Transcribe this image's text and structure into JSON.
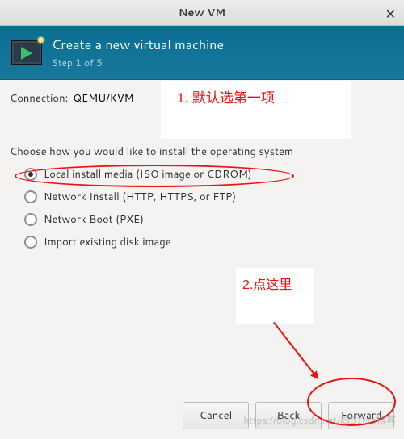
{
  "window": {
    "title": "New VM",
    "close_glyph": "✕"
  },
  "header": {
    "title": "Create a new virtual machine",
    "step": "Step 1 of 5"
  },
  "connection": {
    "label": "Connection:",
    "value": "QEMU/KVM"
  },
  "choose_label": "Choose how you would like to install the operating system",
  "options": [
    {
      "label": "Local install media (ISO image or CDROM)",
      "selected": true
    },
    {
      "label": "Network Install (HTTP, HTTPS, or FTP)",
      "selected": false
    },
    {
      "label": "Network Boot (PXE)",
      "selected": false
    },
    {
      "label": "Import existing disk image",
      "selected": false
    }
  ],
  "buttons": {
    "cancel": "Cancel",
    "back": "Back",
    "forward": "Forward"
  },
  "annotations": {
    "note1": "1.  默认选第一项",
    "note2": "2.点这里"
  },
  "watermark": "https://blog.csdn.net/@51cto博客"
}
